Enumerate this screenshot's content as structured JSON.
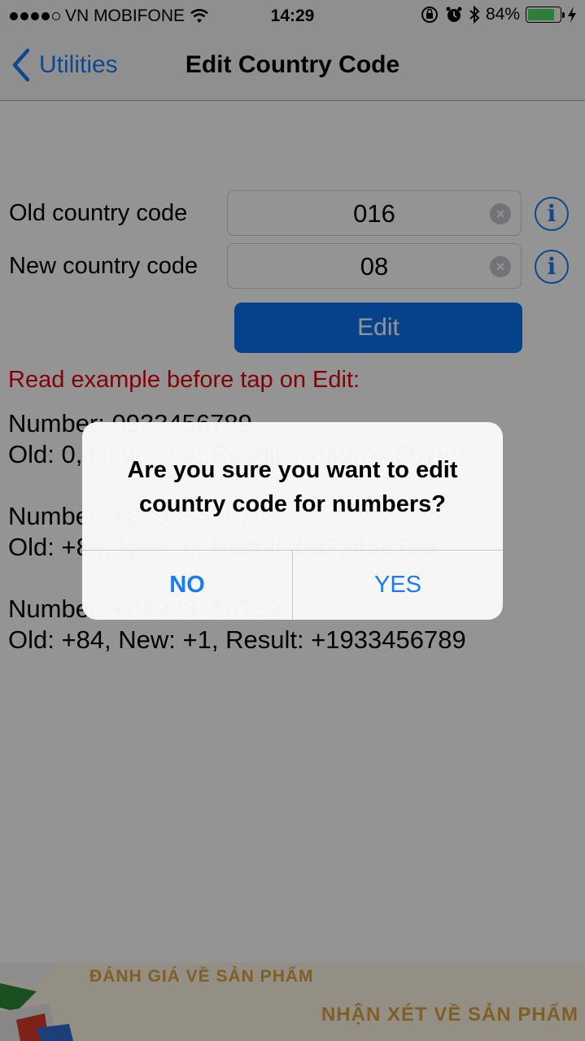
{
  "status_bar": {
    "carrier": "VN MOBIFONE",
    "time": "14:29",
    "battery_percent": "84%",
    "battery_level": 0.84,
    "icons": [
      "wifi-icon",
      "orientation-lock-icon",
      "alarm-icon",
      "bluetooth-icon",
      "battery-icon",
      "charging-icon"
    ]
  },
  "nav": {
    "back_label": "Utilities",
    "title": "Edit Country Code"
  },
  "form": {
    "old_label": "Old country code",
    "old_value": "016",
    "new_label": "New country code",
    "new_value": "08",
    "info_glyph": "i",
    "clear_glyph": "×",
    "edit_label": "Edit"
  },
  "warning": "Read example before tap on Edit:",
  "examples": [
    {
      "line1": "Number: 0933456789",
      "line2": "Old: 0, New: +84, Result: +84933456789"
    },
    {
      "line1": "Number: +84933456789",
      "line2": "Old: +84, New: 0, Result: 0933456789"
    },
    {
      "line1": "Number: +84933456789",
      "line2": "Old: +84, New: +1, Result: +1933456789"
    }
  ],
  "ad": {
    "line1": "ĐÁNH GIÁ VỀ SẢN PHẨM",
    "line2": "NHẬN XÉT VỀ SẢN PHẨM"
  },
  "alert": {
    "message": "Are you sure you want to edit country code for numbers?",
    "no_label": "NO",
    "yes_label": "YES"
  },
  "colors": {
    "accent": "#1a7cf5",
    "edit_button": "#0a73f0",
    "warning": "#e0000a",
    "battery": "#4cd964",
    "ad_text": "#d9a441"
  }
}
